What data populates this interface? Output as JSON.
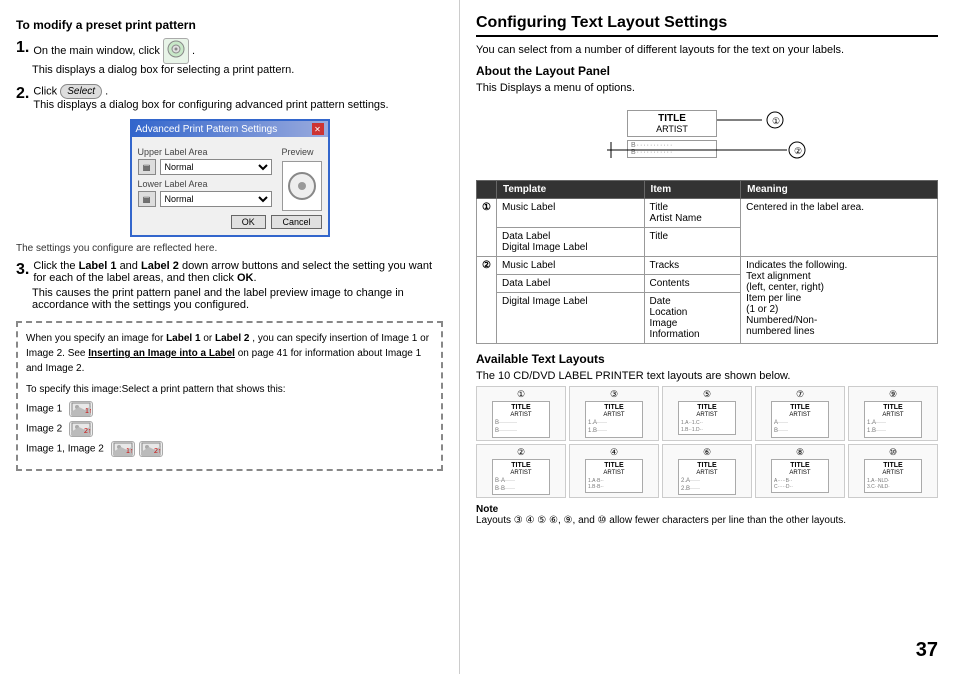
{
  "page": {
    "number": "37"
  },
  "left": {
    "heading": "To modify a preset print pattern",
    "step1": {
      "number": "1.",
      "text1": "On the main window, click",
      "text2": ".",
      "text3": "This displays a dialog box for selecting a print pattern."
    },
    "step2": {
      "number": "2.",
      "text1": "Click",
      "text2": ".",
      "text3": "This displays a dialog box for configuring advanced print pattern settings."
    },
    "dialog": {
      "title": "Advanced Print Pattern Settings",
      "upper_label": "Upper Label Area",
      "lower_label": "Lower Label Area",
      "normal1": "Normal",
      "normal2": "Normal",
      "preview_label": "Preview",
      "ok_btn": "OK",
      "cancel_btn": "Cancel"
    },
    "caption": "The settings you configure are reflected here.",
    "step3": {
      "number": "3.",
      "text1": "Click the",
      "label1": "Label 1",
      "text2": "and",
      "label2": "Label 2",
      "text3": "down arrow buttons and select the setting you want for each of the label areas, and then click",
      "ok": "OK",
      "text4": ".",
      "text5": "This causes the print pattern panel and the label preview image to change in accordance with the settings you configured."
    },
    "note_box": {
      "para1_text1": "When you specify an image for",
      "para1_label1": "Label 1",
      "para1_text2": "or",
      "para1_label2": "Label 2",
      "para1_text3": ", you can specify insertion of Image 1 or Image 2. See",
      "para1_link": "Inserting an Image into a Label",
      "para1_text4": "on page 41 for information about Image 1 and Image 2.",
      "para2": "To specify this image:Select a print pattern that shows this:",
      "image1_label": "Image 1",
      "image2_label": "Image 2",
      "image12_label": "Image 1, Image 2"
    }
  },
  "right": {
    "heading": "Configuring Text Layout Settings",
    "intro": "You can select from a number of different layouts for the text on your labels.",
    "panel_heading": "About the Layout Panel",
    "panel_intro": "This Displays a menu of options.",
    "circle1": "①",
    "circle2": "②",
    "table": {
      "headers": [
        "Template",
        "Item",
        "Meaning"
      ],
      "rows": [
        {
          "row_group": "①",
          "items": [
            {
              "template": "Music Label",
              "item": "Title\nArtist Name",
              "meaning": "Centered in the label area."
            },
            {
              "template": "Data Label\nDigital Image Label",
              "item": "Title",
              "meaning": ""
            }
          ]
        },
        {
          "row_group": "②",
          "items": [
            {
              "template": "Music Label",
              "item": "Tracks",
              "meaning": "Indicates the following."
            },
            {
              "template": "Data Label",
              "item": "Contents",
              "meaning": "Text alignment\n(left, center, right)\nItem per line\n(1 or 2)\nNumbered/Non-\nnumbered lines"
            },
            {
              "template": "Digital Image Label",
              "item": "Date\nLocation\nImage\nInformation",
              "meaning": ""
            }
          ]
        }
      ]
    },
    "layouts_heading": "Available Text Layouts",
    "layouts_intro": "The 10 CD/DVD LABEL PRINTER text layouts are shown below.",
    "layouts": [
      {
        "num": "①",
        "title": "TITLE",
        "artist": "ARTIST",
        "lines": [
          "B·········",
          "B·········"
        ]
      },
      {
        "num": "③",
        "title": "TITLE",
        "artist": "ARTIST",
        "lines": [
          "1.A·····",
          "1.B·····"
        ]
      },
      {
        "num": "⑤",
        "title": "TITLE",
        "artist": "ARTIST",
        "lines": [
          "1.A··1.C··",
          "1.B··1.D··"
        ]
      },
      {
        "num": "⑦",
        "title": "TITLE",
        "artist": "ARTIST",
        "lines": [
          "A·····",
          "B·····"
        ]
      },
      {
        "num": "⑨",
        "title": "TITLE",
        "artist": "ARTIST",
        "lines": [
          "1.A·····",
          "1.B·····"
        ]
      },
      {
        "num": "②",
        "title": "TITLE",
        "artist": "ARTIST",
        "lines": [
          "B·A·····",
          "B·B·····"
        ]
      },
      {
        "num": "④",
        "title": "TITLE",
        "artist": "ARTIST",
        "lines": [
          "1.A·B··",
          "1.B·B··"
        ]
      },
      {
        "num": "⑥",
        "title": "TITLE",
        "artist": "ARTIST",
        "lines": [
          "2.A·····",
          "2.B·····"
        ]
      },
      {
        "num": "⑧",
        "title": "TITLE",
        "artist": "ARTIST",
        "lines": [
          "A·····B··",
          "C·····D··"
        ]
      },
      {
        "num": "⑩",
        "title": "TITLE",
        "artist": "ARTIST",
        "lines": [
          "1.A··NLD·",
          "3.C··NLD·"
        ]
      }
    ],
    "note": {
      "title": "Note",
      "text": "Layouts ③ ④ ⑤ ⑥, ⑨, and ⑩ allow fewer characters per line than the other layouts."
    }
  }
}
